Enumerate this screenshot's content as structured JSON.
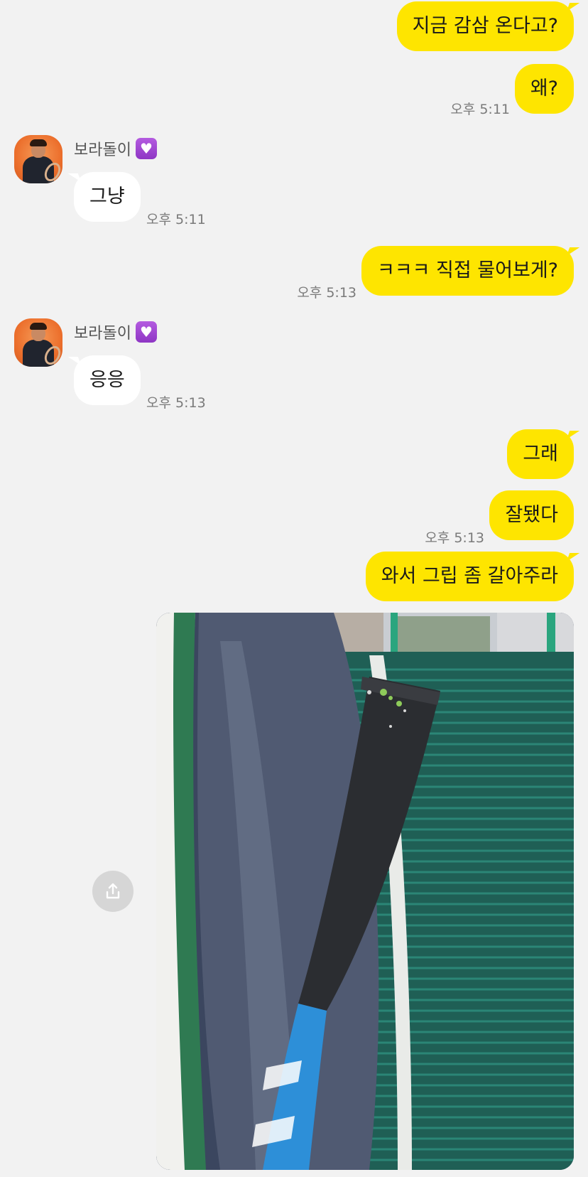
{
  "messages": {
    "m1": {
      "text": "지금 감삼 온다고?"
    },
    "m2": {
      "text": "왜?",
      "time": "오후 5:11"
    },
    "m3": {
      "sender": "보라돌이",
      "text": "그냥",
      "time": "오후 5:11"
    },
    "m4": {
      "text": "ㅋㅋㅋ 직접 물어보게?",
      "time": "오후 5:13"
    },
    "m5": {
      "sender": "보라돌이",
      "text": "응응",
      "time": "오후 5:13"
    },
    "m6": {
      "text": "그래"
    },
    "m7": {
      "text": "잘됐다",
      "time": "오후 5:13"
    },
    "m8": {
      "text": "와서 그립 좀 갈아주라"
    }
  },
  "badge_icon": "purple-heart-icon",
  "photo": {
    "subject": "tennis racket grip in bag"
  },
  "share_icon": "share-icon",
  "colors": {
    "outgoing": "#fee500",
    "incoming": "#ffffff",
    "background": "#f2f2f2"
  }
}
